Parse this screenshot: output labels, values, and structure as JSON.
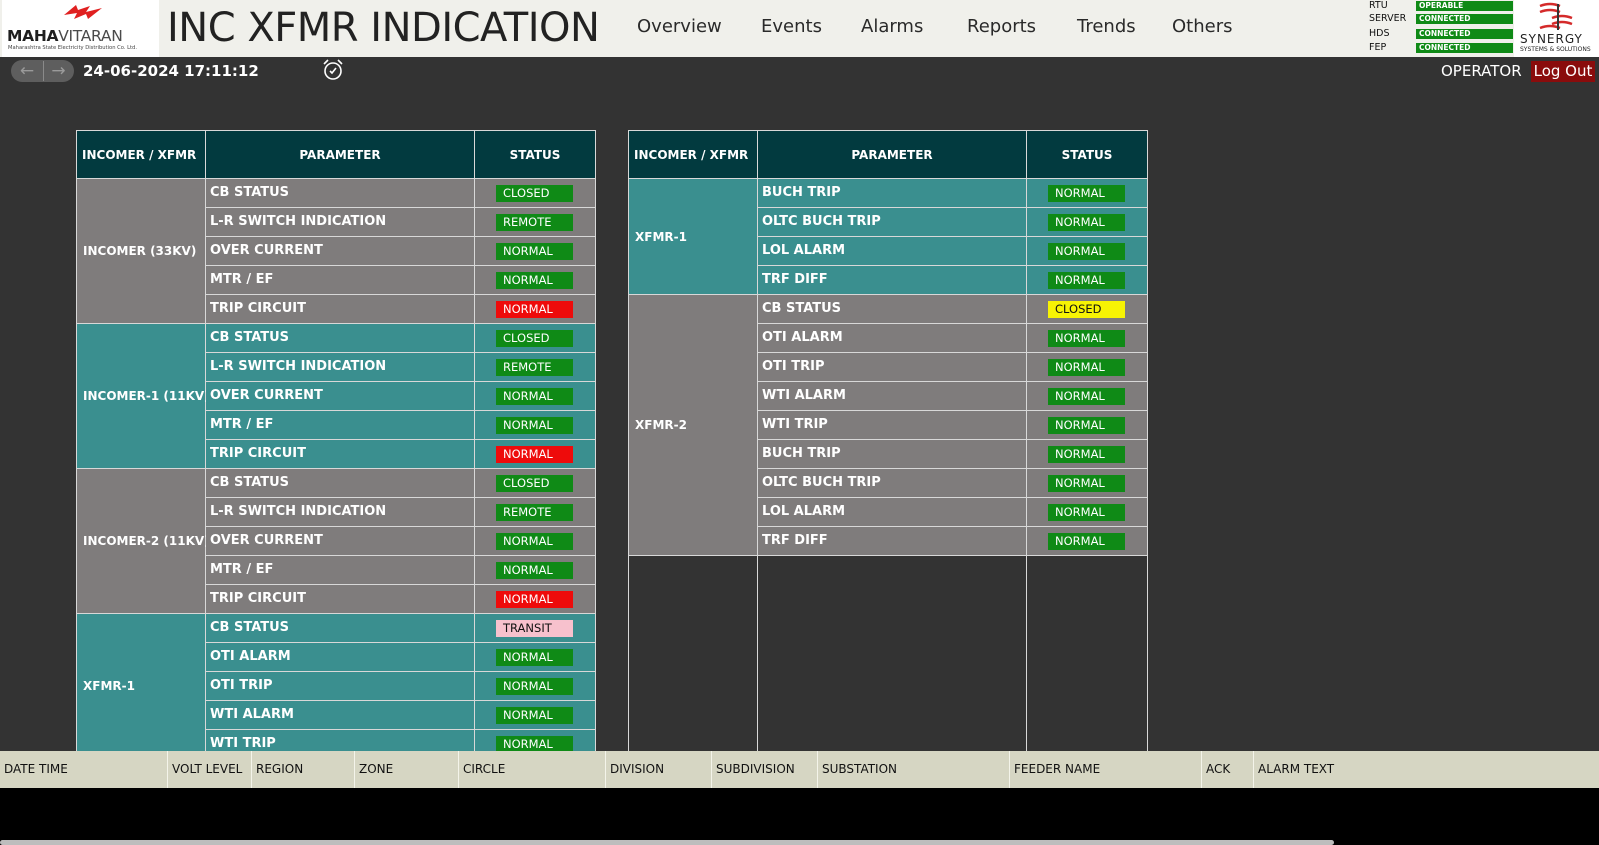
{
  "header": {
    "logo": {
      "brand_bold": "MAHA",
      "brand_rest": "VITARAN",
      "tagline": "Maharashtra State Electricity Distribution Co. Ltd."
    },
    "title": "INC XFMR INDICATION",
    "nav": [
      "Overview",
      "Events",
      "Alarms",
      "Reports",
      "Trends",
      "Others"
    ],
    "status_panel": [
      {
        "label": "RTU",
        "value": "OPERABLE"
      },
      {
        "label": "SERVER",
        "value": "CONNECTED"
      },
      {
        "label": "HDS",
        "value": "CONNECTED"
      },
      {
        "label": "FEP",
        "value": "CONNECTED"
      }
    ],
    "synergy_logo": {
      "name": "SYNERGY",
      "tagline": "SYSTEMS & SOLUTIONS"
    },
    "status_color": "#0f8a16"
  },
  "subbar": {
    "datetime": "24-06-2024 17:11:12",
    "user": "OPERATOR",
    "logout": "Log Out",
    "icons": [
      "back-arrow-icon",
      "forward-arrow-icon",
      "alarm-clock-icon"
    ]
  },
  "columns": {
    "group": "INCOMER / XFMR",
    "parameter": "PARAMETER",
    "status": "STATUS"
  },
  "left_table": [
    {
      "group": "INCOMER (33KV)",
      "color": "grey",
      "rows": [
        {
          "param": "CB STATUS",
          "status": "CLOSED",
          "color": "green"
        },
        {
          "param": "L-R SWITCH INDICATION",
          "status": "REMOTE",
          "color": "green"
        },
        {
          "param": "OVER CURRENT",
          "status": "NORMAL",
          "color": "green"
        },
        {
          "param": "MTR / EF",
          "status": "NORMAL",
          "color": "green"
        },
        {
          "param": "TRIP CIRCUIT",
          "status": "NORMAL",
          "color": "red"
        }
      ]
    },
    {
      "group": "INCOMER-1 (11KV)",
      "color": "teal",
      "rows": [
        {
          "param": "CB STATUS",
          "status": "CLOSED",
          "color": "green"
        },
        {
          "param": "L-R SWITCH INDICATION",
          "status": "REMOTE",
          "color": "green"
        },
        {
          "param": "OVER CURRENT",
          "status": "NORMAL",
          "color": "green"
        },
        {
          "param": "MTR / EF",
          "status": "NORMAL",
          "color": "green"
        },
        {
          "param": "TRIP CIRCUIT",
          "status": "NORMAL",
          "color": "red"
        }
      ]
    },
    {
      "group": "INCOMER-2 (11KV)",
      "color": "grey",
      "rows": [
        {
          "param": "CB STATUS",
          "status": "CLOSED",
          "color": "green"
        },
        {
          "param": "L-R SWITCH INDICATION",
          "status": "REMOTE",
          "color": "green"
        },
        {
          "param": "OVER CURRENT",
          "status": "NORMAL",
          "color": "green"
        },
        {
          "param": "MTR / EF",
          "status": "NORMAL",
          "color": "green"
        },
        {
          "param": "TRIP CIRCUIT",
          "status": "NORMAL",
          "color": "red"
        }
      ]
    },
    {
      "group": "XFMR-1",
      "color": "teal",
      "rows": [
        {
          "param": "CB STATUS",
          "status": "TRANSIT",
          "color": "pink"
        },
        {
          "param": "OTI ALARM",
          "status": "NORMAL",
          "color": "green"
        },
        {
          "param": "OTI TRIP",
          "status": "NORMAL",
          "color": "green"
        },
        {
          "param": "WTI ALARM",
          "status": "NORMAL",
          "color": "green"
        },
        {
          "param": "WTI TRIP",
          "status": "NORMAL",
          "color": "green"
        }
      ]
    }
  ],
  "right_table": [
    {
      "group": "XFMR-1",
      "color": "teal",
      "rows": [
        {
          "param": "BUCH TRIP",
          "status": "NORMAL",
          "color": "green"
        },
        {
          "param": "OLTC BUCH TRIP",
          "status": "NORMAL",
          "color": "green"
        },
        {
          "param": "LOL ALARM",
          "status": "NORMAL",
          "color": "green"
        },
        {
          "param": "TRF DIFF",
          "status": "NORMAL",
          "color": "green"
        }
      ]
    },
    {
      "group": "XFMR-2",
      "color": "grey",
      "rows": [
        {
          "param": "CB STATUS",
          "status": "CLOSED",
          "color": "yellow"
        },
        {
          "param": "OTI ALARM",
          "status": "NORMAL",
          "color": "green"
        },
        {
          "param": "OTI TRIP",
          "status": "NORMAL",
          "color": "green"
        },
        {
          "param": "WTI ALARM",
          "status": "NORMAL",
          "color": "green"
        },
        {
          "param": "WTI TRIP",
          "status": "NORMAL",
          "color": "green"
        },
        {
          "param": "BUCH TRIP",
          "status": "NORMAL",
          "color": "green"
        },
        {
          "param": "OLTC BUCH TRIP",
          "status": "NORMAL",
          "color": "green"
        },
        {
          "param": "LOL ALARM",
          "status": "NORMAL",
          "color": "green"
        },
        {
          "param": "TRF DIFF",
          "status": "NORMAL",
          "color": "green"
        }
      ]
    }
  ],
  "alarm_grid": {
    "columns": [
      "DATE TIME",
      "VOLT LEVEL",
      "REGION",
      "ZONE",
      "CIRCLE",
      "DIVISION",
      "SUBDIVISION",
      "SUBSTATION",
      "FEEDER NAME",
      "ACK",
      "ALARM TEXT"
    ],
    "rows": []
  },
  "colors": {
    "teal": "#3a8f8f",
    "grey": "#7f7c7c",
    "header": "#023a3f",
    "green": "#0f8a16",
    "red": "#ee0b0b",
    "yellow": "#f7f304",
    "pink": "#f7c1cd",
    "logout": "#8a0c0c"
  }
}
